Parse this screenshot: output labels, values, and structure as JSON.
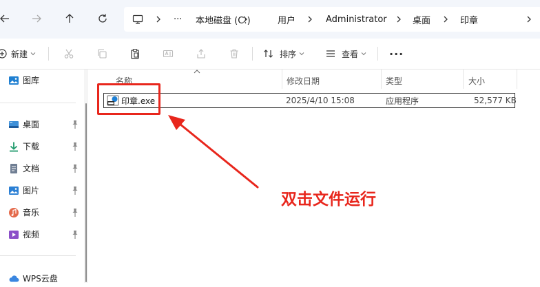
{
  "address": {
    "segments": [
      "本地磁盘 (C:)",
      "用户",
      "Administrator",
      "桌面",
      "印章"
    ],
    "more": "···"
  },
  "toolbar": {
    "new_label": "新建",
    "sort_label": "排序",
    "view_label": "查看",
    "more": "···"
  },
  "sidebar": {
    "items": [
      {
        "label": "图库",
        "icon": "gallery-icon",
        "pinned": false
      },
      {
        "label": "桌面",
        "icon": "desktop-icon",
        "pinned": true
      },
      {
        "label": "下载",
        "icon": "download-icon",
        "pinned": true
      },
      {
        "label": "文档",
        "icon": "documents-icon",
        "pinned": true
      },
      {
        "label": "图片",
        "icon": "pictures-icon",
        "pinned": true
      },
      {
        "label": "音乐",
        "icon": "music-icon",
        "pinned": true
      },
      {
        "label": "视频",
        "icon": "videos-icon",
        "pinned": true
      },
      {
        "label": "WPS云盘",
        "icon": "wps-cloud-icon",
        "pinned": false
      }
    ]
  },
  "columns": {
    "name": "名称",
    "date": "修改日期",
    "type": "类型",
    "size": "大小"
  },
  "files": [
    {
      "name": "印章.exe",
      "date": "2025/4/10 15:08",
      "type": "应用程序",
      "size": "52,577 KB",
      "icon": "exe-icon"
    }
  ],
  "annotation": {
    "text": "双击文件运行",
    "color": "#e8261c"
  }
}
